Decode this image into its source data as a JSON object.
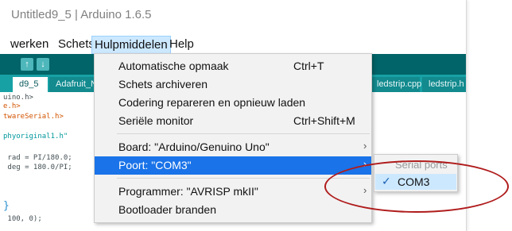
{
  "window": {
    "title": "Untitled9_5 | Arduino 1.6.5"
  },
  "menubar": {
    "items": [
      {
        "label": "werken"
      },
      {
        "label": "Schets"
      },
      {
        "label": "Hulpmiddelen"
      },
      {
        "label": "Help"
      }
    ]
  },
  "toolbar": {
    "buttons": [
      {
        "icon": "upload-icon",
        "glyph": "↑"
      },
      {
        "icon": "save-icon",
        "glyph": "↓"
      }
    ]
  },
  "tabs": [
    {
      "label": "d9_5"
    },
    {
      "label": "Adafruit_N"
    },
    {
      "label": "ledstrip.cpp"
    },
    {
      "label": "ledstrip.h"
    }
  ],
  "code": {
    "lines": [
      "uino.h>",
      "e.h>",
      "twareSerial.h>",
      "",
      "phyoriginal1.h\"",
      "",
      " rad = PI/180.0;",
      " deg = 180.0/PI;",
      "",
      "",
      "",
      "}",
      " 100, 0);"
    ]
  },
  "menu": {
    "items": [
      {
        "label": "Automatische opmaak",
        "shortcut": "Ctrl+T",
        "submenu": false
      },
      {
        "label": "Schets archiveren",
        "shortcut": "",
        "submenu": false
      },
      {
        "label": "Codering repareren en opnieuw laden",
        "shortcut": "",
        "submenu": false
      },
      {
        "label": "Seriële monitor",
        "shortcut": "Ctrl+Shift+M",
        "submenu": false
      },
      {
        "label": "Board: \"Arduino/Genuino Uno\"",
        "shortcut": "",
        "submenu": true
      },
      {
        "label": "Poort: \"COM3\"",
        "shortcut": "",
        "submenu": true,
        "highlighted": true
      },
      {
        "label": "Programmer: \"AVRISP mkII\"",
        "shortcut": "",
        "submenu": true
      },
      {
        "label": "Bootloader branden",
        "shortcut": "",
        "submenu": false
      }
    ],
    "arrow_glyph": "›"
  },
  "submenu": {
    "header": "Serial ports",
    "item": {
      "label": "COM3",
      "checked": true,
      "check_glyph": "✓"
    }
  },
  "colors": {
    "toolbar": "#006468",
    "tabbar": "#17a1a5",
    "highlight": "#1a73e8",
    "annotation": "#b01c1c"
  }
}
